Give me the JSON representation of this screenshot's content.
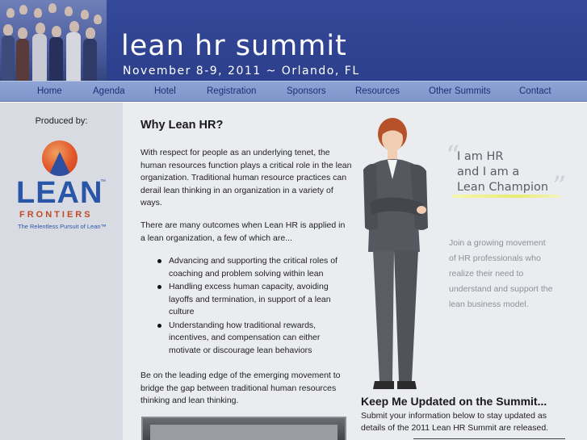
{
  "header": {
    "title": "lean hr summit",
    "subtitle": "November 8-9, 2011 ~ Orlando, FL"
  },
  "nav": {
    "items": [
      {
        "label": "Home"
      },
      {
        "label": "Agenda"
      },
      {
        "label": "Hotel"
      },
      {
        "label": "Registration"
      },
      {
        "label": "Sponsors"
      },
      {
        "label": "Resources"
      },
      {
        "label": "Other Summits"
      },
      {
        "label": "Contact"
      }
    ]
  },
  "sidebar": {
    "produced_by": "Produced by:",
    "logo": {
      "name": "LEAN",
      "frontiers": "FRONTIERS",
      "tagline": "The Relentless Pursuit of Lean™",
      "trademark": "™"
    }
  },
  "main": {
    "heading": "Why Lean HR?",
    "para1": "With respect for people as an underlying tenet, the human resources function plays a critical role in the lean organization. Traditional human resource practices can derail lean thinking in an organization in a variety of ways.",
    "para2": "There are many outcomes when Lean HR is applied in a lean organization, a few of which are...",
    "bullets": [
      "Advancing and supporting the critical roles of coaching and problem solving within lean",
      "Handling excess human capacity, avoiding layoffs and termination, in support of a lean culture",
      "Understanding how traditional rewards, incentives, and compensation can either motivate or discourage lean behaviors"
    ],
    "para3": "Be on the leading edge of the emerging movement to bridge the gap between traditional human resources thinking and lean thinking."
  },
  "quote": {
    "line1": "I am HR",
    "line2": "and I am a",
    "line3": "Lean Champion",
    "join": "Join a growing movement of HR professionals who realize their need to understand and support the lean business model."
  },
  "keep_updated": {
    "title": "Keep Me Updated on the Summit...",
    "text": "Submit your information below to stay updated as details of the 2011 Lean HR Summit are released."
  },
  "colors": {
    "header_blue": "#2f4390",
    "nav_blue": "#8499cf",
    "nav_text": "#1c2f75",
    "sidebar_gray": "#d9dbe3",
    "main_bg": "#ebecf0",
    "logo_orange": "#e2582a",
    "logo_blue": "#2a56a8"
  }
}
